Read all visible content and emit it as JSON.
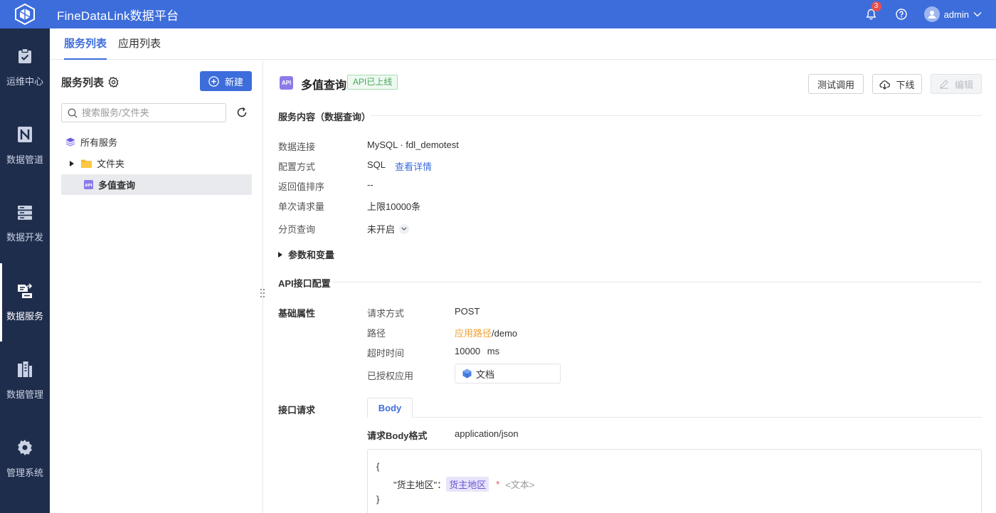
{
  "app": {
    "title": "FineDataLink数据平台",
    "notifications": "3",
    "user": "admin"
  },
  "nav": [
    {
      "label": "运维中心",
      "icon": "clipboard-check-icon"
    },
    {
      "label": "数据管道",
      "icon": "pipeline-icon"
    },
    {
      "label": "数据开发",
      "icon": "server-icon"
    },
    {
      "label": "数据服务",
      "icon": "data-service-icon",
      "active": true
    },
    {
      "label": "数据管理",
      "icon": "data-manage-icon"
    },
    {
      "label": "管理系统",
      "icon": "gear-icon"
    }
  ],
  "tabs": {
    "service_list": "服务列表",
    "app_list": "应用列表"
  },
  "panel": {
    "title": "服务列表",
    "new_button": "新建",
    "search_placeholder": "搜索服务/文件夹",
    "tree": {
      "root": "所有服务",
      "folder": "文件夹",
      "selected": "多值查询"
    }
  },
  "api": {
    "icon_text": "API",
    "name": "多值查询",
    "status": "API已上线",
    "buttons": {
      "test": "测试调用",
      "offline": "下线",
      "edit": "编辑"
    }
  },
  "service_content": {
    "heading": "服务内容（数据查询）",
    "data_connection_label": "数据连接",
    "data_connection_value": "MySQL · fdl_demotest",
    "config_mode_label": "配置方式",
    "config_mode_value": "SQL",
    "config_mode_link": "查看详情",
    "return_sort_label": "返回值排序",
    "return_sort_value": "--",
    "single_request_label": "单次请求量",
    "single_request_value": "上限10000条",
    "paging_label": "分页查询",
    "paging_value": "未开启",
    "params_toggle": "参数和变量"
  },
  "api_config": {
    "heading": "API接口配置",
    "basic_label": "基础属性",
    "method_label": "请求方式",
    "method_value": "POST",
    "path_label": "路径",
    "path_prefix": "应用路径",
    "path_suffix": "/demo",
    "timeout_label": "超时时间",
    "timeout_value": "10000",
    "timeout_unit": "ms",
    "authorized_label": "已授权应用",
    "authorized_value": "文档",
    "request_label": "接口请求",
    "body_tab": "Body",
    "body_format_label": "请求Body格式",
    "body_format_value": "application/json",
    "code": {
      "open": "{",
      "key": "\"货主地区\"：",
      "var": "货主地区",
      "required": "*",
      "type_hint": "<文本>",
      "close": "}"
    }
  },
  "colors": {
    "primary": "#3d6ddb",
    "nav_bg": "#1f2d4c",
    "status_green": "#47a85b",
    "path_orange": "#f0a030"
  }
}
